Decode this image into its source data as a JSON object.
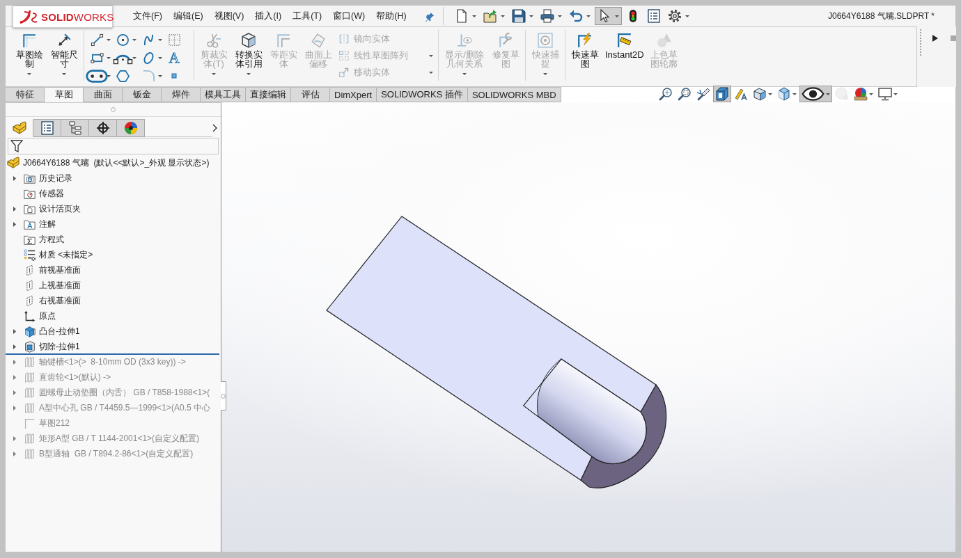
{
  "title_bar": {
    "logo": "**SOLID**WORKS",
    "menus": [
      "文件(F)",
      "编辑(E)",
      "视图(V)",
      "插入(I)",
      "工具(T)",
      "窗口(W)",
      "帮助(H)"
    ],
    "quick_access": [
      {
        "kind": "new",
        "dropdown": true,
        "pressed": false
      },
      {
        "kind": "open",
        "dropdown": true,
        "pressed": false
      },
      {
        "kind": "save",
        "dropdown": true,
        "pressed": false
      },
      {
        "kind": "print",
        "dropdown": true,
        "pressed": false
      },
      {
        "kind": "undo",
        "dropdown": true,
        "pressed": false
      },
      {
        "kind": "select",
        "dropdown": true,
        "pressed": true
      },
      {
        "kind": "rebuild",
        "dropdown": false,
        "pressed": false
      },
      {
        "kind": "properties",
        "dropdown": false,
        "pressed": false
      },
      {
        "kind": "options",
        "dropdown": true,
        "pressed": false
      }
    ],
    "document_title": "J0664Y6188 气嘴.SLDPRT *"
  },
  "ribbon": {
    "groups": [
      {
        "blocks": [
          {
            "kind": "large",
            "commands": [
              {
                "kind": "sketch",
                "label": "草图绘制",
                "disabled": false,
                "dropdown": true
              },
              {
                "kind": "dimension",
                "label": "智能尺寸",
                "disabled": false,
                "dropdown": true
              }
            ]
          }
        ]
      },
      {
        "blocks": [
          {
            "kind": "grid",
            "commands": [
              {
                "kind": "line",
                "disabled": false,
                "dropdown": true
              },
              {
                "kind": "circle",
                "disabled": false,
                "dropdown": true
              },
              {
                "kind": "spline",
                "disabled": false,
                "dropdown": true
              },
              {
                "kind": "dotted",
                "disabled": false,
                "dropdown": false
              },
              {
                "kind": "rectangle",
                "disabled": false,
                "dropdown": true
              },
              {
                "kind": "arc",
                "disabled": false,
                "dropdown": true
              },
              {
                "kind": "ellipse",
                "disabled": false,
                "dropdown": true
              },
              {
                "kind": "text",
                "glyph": "A",
                "disabled": false,
                "dropdown": false
              },
              {
                "kind": "slot",
                "disabled": false,
                "dropdown": true
              },
              {
                "kind": "polygon",
                "disabled": false,
                "dropdown": false
              },
              {
                "kind": "fillet",
                "disabled": true,
                "dropdown": true
              },
              {
                "kind": "point",
                "disabled": false,
                "dropdown": false
              }
            ]
          }
        ]
      },
      {
        "blocks": [
          {
            "kind": "large",
            "commands": [
              {
                "kind": "trim",
                "label": "剪裁实体(T)",
                "disabled": true,
                "dropdown": true
              },
              {
                "kind": "convert",
                "label": "转换实体引用",
                "disabled": false,
                "dropdown": true
              },
              {
                "kind": "offset",
                "label": "等距实体",
                "disabled": true,
                "dropdown": false
              },
              {
                "kind": "surfaceoffset",
                "label": "曲面上偏移",
                "disabled": true,
                "dropdown": false
              }
            ]
          },
          {
            "kind": "list",
            "commands": [
              {
                "kind": "mirror",
                "label": "镜向实体",
                "disabled": true,
                "dropdown": false
              },
              {
                "kind": "pattern",
                "label": "线性草图阵列",
                "disabled": true,
                "dropdown": true
              },
              {
                "kind": "move",
                "label": "移动实体",
                "disabled": true,
                "dropdown": true
              }
            ]
          }
        ]
      },
      {
        "blocks": [
          {
            "kind": "large",
            "commands": [
              {
                "kind": "relations",
                "label": "显示/删除几何关系",
                "disabled": true,
                "dropdown": true
              },
              {
                "kind": "repair",
                "label": "修复草图",
                "disabled": true,
                "dropdown": false
              }
            ]
          }
        ]
      },
      {
        "blocks": [
          {
            "kind": "large",
            "commands": [
              {
                "kind": "snaps",
                "label": "快速捕捉",
                "disabled": true,
                "dropdown": true
              }
            ]
          }
        ]
      },
      {
        "blocks": [
          {
            "kind": "large",
            "commands": [
              {
                "kind": "rapid",
                "label": "快速草图",
                "disabled": false,
                "dropdown": false
              },
              {
                "kind": "instant2d",
                "label": "Instant2D",
                "disabled": false,
                "dropdown": false
              },
              {
                "kind": "shaded",
                "label": "上色草图轮廓",
                "disabled": true,
                "dropdown": false
              }
            ]
          }
        ]
      }
    ]
  },
  "command_tabs": [
    {
      "label": "特征",
      "selected": false
    },
    {
      "label": "草图",
      "selected": true
    },
    {
      "label": "曲面",
      "selected": false
    },
    {
      "label": "钣金",
      "selected": false
    },
    {
      "label": "焊件",
      "selected": false
    },
    {
      "label": "模具工具",
      "selected": false
    },
    {
      "label": "直接编辑",
      "selected": false
    },
    {
      "label": "评估",
      "selected": false
    },
    {
      "label": "DimXpert",
      "selected": false
    },
    {
      "label": "SOLIDWORKS 插件",
      "selected": false
    },
    {
      "label": "SOLIDWORKS MBD",
      "selected": false
    }
  ],
  "view_toolbar": [
    {
      "kind": "zoomfit",
      "pressed": false,
      "dropdown": false,
      "disabled": false
    },
    {
      "kind": "zoomarea",
      "pressed": false,
      "dropdown": false,
      "disabled": false
    },
    {
      "kind": "previous",
      "pressed": false,
      "dropdown": false,
      "disabled": false
    },
    {
      "kind": "section",
      "pressed": true,
      "dropdown": false,
      "disabled": false
    },
    {
      "kind": "annotations",
      "pressed": false,
      "dropdown": false,
      "disabled": false
    },
    {
      "kind": "orientation",
      "pressed": false,
      "dropdown": true,
      "disabled": false
    },
    {
      "kind": "displaystyle",
      "pressed": false,
      "dropdown": true,
      "disabled": false
    },
    {
      "kind": "hideshow",
      "pressed": true,
      "dropdown": true,
      "disabled": false
    },
    {
      "kind": "appearance",
      "pressed": false,
      "dropdown": false,
      "disabled": true
    },
    {
      "kind": "scene",
      "pressed": false,
      "dropdown": true,
      "disabled": false
    },
    {
      "kind": "settings",
      "pressed": false,
      "dropdown": true,
      "disabled": false
    }
  ],
  "manager_panel": {
    "tabs": [
      {
        "kind": "features",
        "selected": true
      },
      {
        "kind": "properties",
        "selected": false
      },
      {
        "kind": "configurations",
        "selected": false
      },
      {
        "kind": "dimxpert",
        "selected": false
      },
      {
        "kind": "display",
        "selected": false
      }
    ],
    "feature_tree": {
      "root": {
        "kind": "part",
        "label": "J0664Y6188 气嘴  (默认<<默认>_外观 显示状态>)",
        "children": [
          {
            "kind": "history",
            "label": "历史记录",
            "expandable": true,
            "rolled_back": false
          },
          {
            "kind": "sensors",
            "label": "传感器",
            "expandable": false,
            "rolled_back": false
          },
          {
            "kind": "binder",
            "label": "设计活页夹",
            "expandable": true,
            "rolled_back": false
          },
          {
            "kind": "annotations",
            "label": "注解",
            "expandable": true,
            "rolled_back": false
          },
          {
            "kind": "equations",
            "label": "方程式",
            "expandable": false,
            "rolled_back": false
          },
          {
            "kind": "material",
            "label": "材质 <未指定>",
            "expandable": false,
            "rolled_back": false
          },
          {
            "kind": "plane",
            "label": "前视基准面",
            "expandable": false,
            "rolled_back": false
          },
          {
            "kind": "plane",
            "label": "上视基准面",
            "expandable": false,
            "rolled_back": false
          },
          {
            "kind": "plane",
            "label": "右视基准面",
            "expandable": false,
            "rolled_back": false
          },
          {
            "kind": "origin",
            "label": "原点",
            "expandable": false,
            "rolled_back": false
          },
          {
            "kind": "boss",
            "label": "凸台-拉伸1",
            "expandable": true,
            "rolled_back": false
          },
          {
            "kind": "cut",
            "label": "切除-拉伸1",
            "expandable": true,
            "rolled_back": false
          },
          {
            "kind": "component",
            "label": "轴键槽<1>(>  8-10mm OD (3x3 key)) ->",
            "expandable": true,
            "rolled_back": true
          },
          {
            "kind": "component",
            "label": "直齿轮<1>(默认) ->",
            "expandable": true,
            "rolled_back": true
          },
          {
            "kind": "component",
            "label": "圆螺母止动垫圈（内舌） GB / T858-1988<1>(",
            "expandable": true,
            "rolled_back": true
          },
          {
            "kind": "component",
            "label": "A型中心孔 GB / T4459.5—1999<1>(A0.5 中心",
            "expandable": true,
            "rolled_back": true
          },
          {
            "kind": "sketch",
            "label": "草图212",
            "expandable": false,
            "rolled_back": true
          },
          {
            "kind": "component",
            "label": "矩形A型 GB / T 1144-2001<1>(自定义配置)",
            "expandable": true,
            "rolled_back": true
          },
          {
            "kind": "component",
            "label": "B型通轴  GB / T894.2-86<1>(自定义配置)",
            "expandable": true,
            "rolled_back": true
          }
        ]
      }
    }
  }
}
